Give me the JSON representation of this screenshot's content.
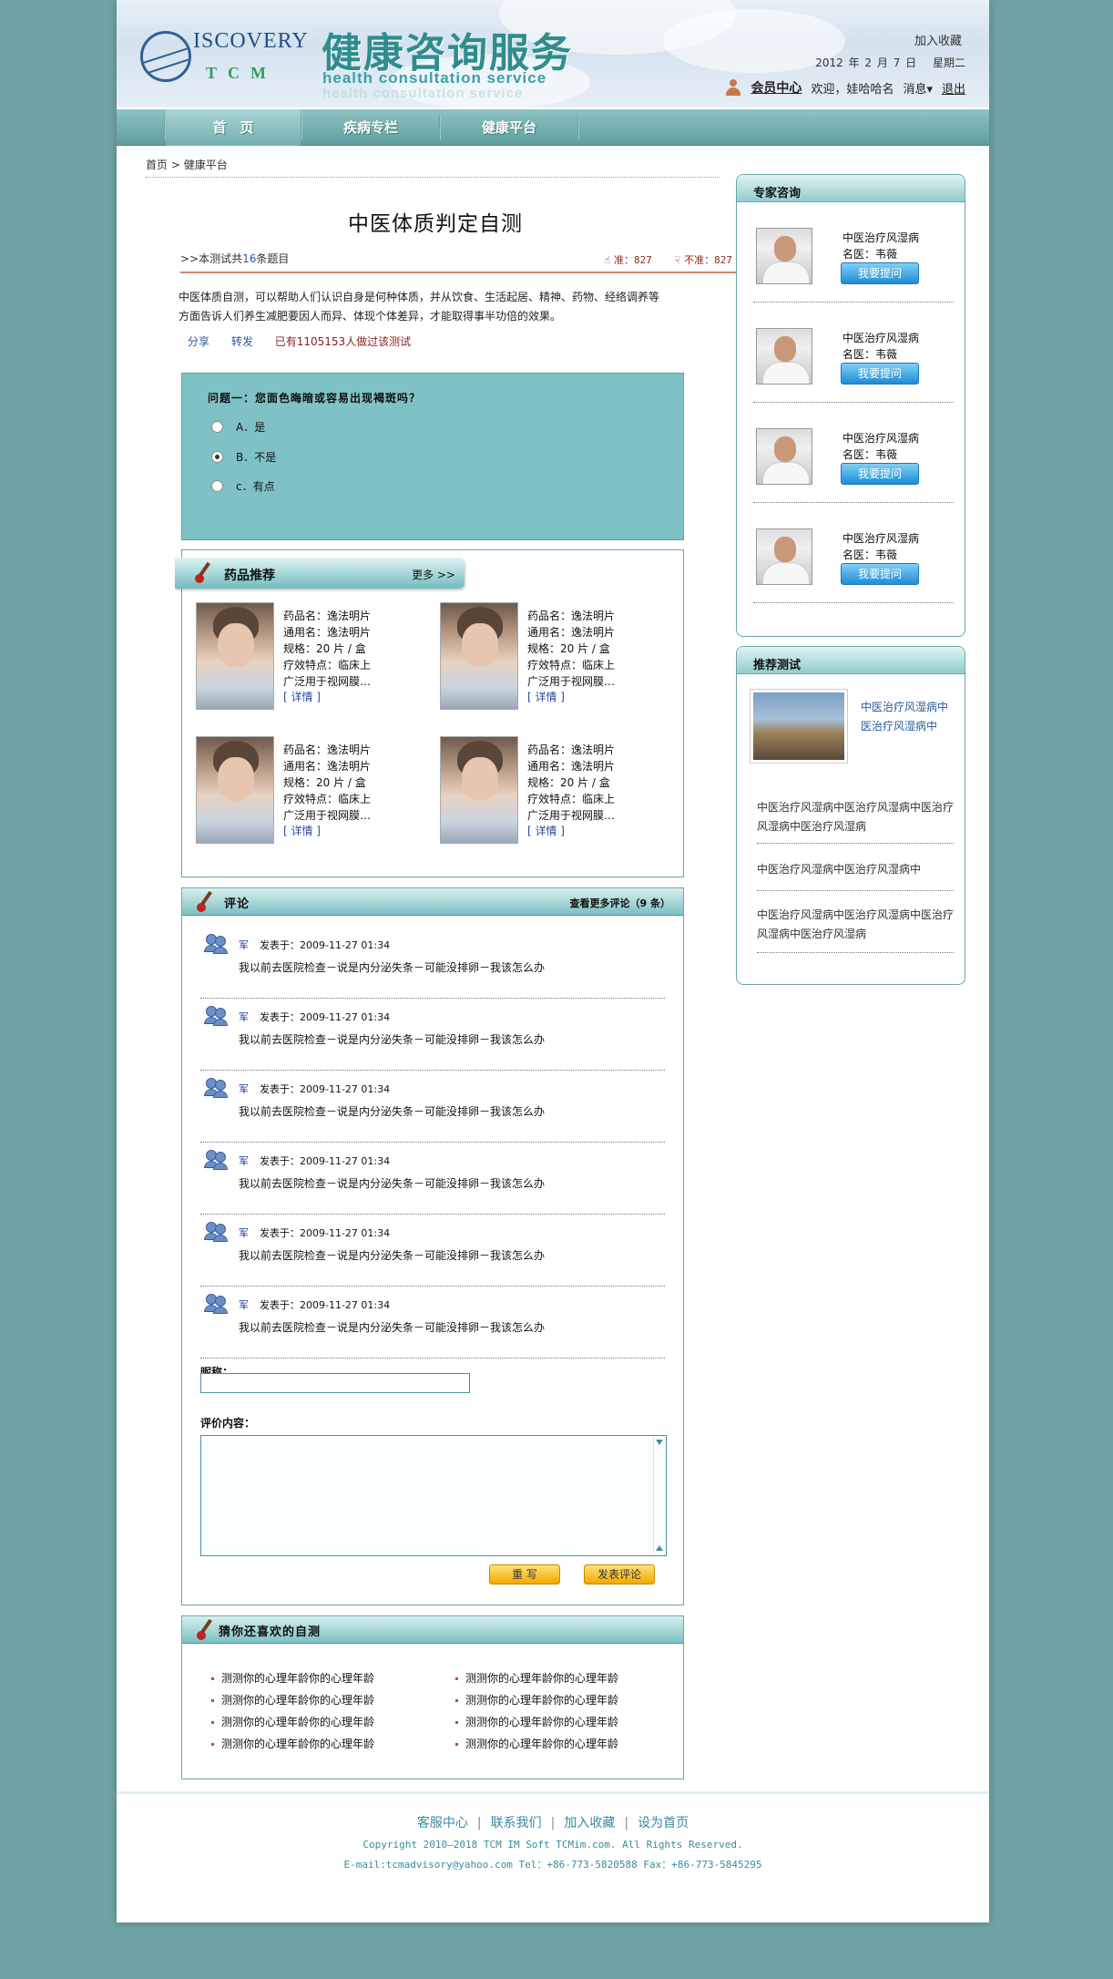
{
  "header": {
    "logo_brand": "ISCOVERY",
    "logo_sub": "TCM",
    "title": "健康咨询服务",
    "subtitle": "health consultation service",
    "add_favorite": "加入收藏",
    "date": "2012 年 2 月 7 日",
    "weekday": "星期二",
    "member_center": "会员中心",
    "welcome": "欢迎，娃哈哈名",
    "messages": "消息▾",
    "logout": "退出"
  },
  "nav": [
    {
      "label": "首　页",
      "active": true
    },
    {
      "label": "疾病专栏",
      "active": false
    },
    {
      "label": "健康平台",
      "active": false
    }
  ],
  "breadcrumb": {
    "home": "首页",
    "sep": ">",
    "current": "健康平台"
  },
  "test": {
    "title": "中医体质判定自测",
    "count_prefix": ">>本测试共",
    "count": "16",
    "count_suffix": "条题目",
    "accurate": "准：827",
    "inaccurate": "不准：827",
    "description": "中医体质自测，可以帮助人们认识自身是何种体质，并从饮食、生活起居、精神、药物、经络调养等方面告诉人们养生减肥要因人而异、体现个体差异，才能取得事半功倍的效果。",
    "share": "分享",
    "forward": "转发",
    "taken": "已有1105153人做过该测试"
  },
  "question": {
    "text": "问题一：您面色晦暗或容易出现褐斑吗？",
    "options": [
      {
        "label": "A．是",
        "selected": false
      },
      {
        "label": "B．不是",
        "selected": true
      },
      {
        "label": "c．有点",
        "selected": false
      }
    ]
  },
  "drugs": {
    "title": "药品推荐",
    "more": "更多 >>",
    "items": [
      {
        "name": "药品名：逸法明片",
        "generic": "通用名：逸法明片",
        "spec": "规格：20 片 / 盒",
        "feat": "疗效特点：临床上",
        "feat2": "广泛用于视网膜…",
        "detail": "[ 详情 ]"
      },
      {
        "name": "药品名：逸法明片",
        "generic": "通用名：逸法明片",
        "spec": "规格：20 片 / 盒",
        "feat": "疗效特点：临床上",
        "feat2": "广泛用于视网膜…",
        "detail": "[ 详情 ]"
      },
      {
        "name": "药品名：逸法明片",
        "generic": "通用名：逸法明片",
        "spec": "规格：20 片 / 盒",
        "feat": "疗效特点：临床上",
        "feat2": "广泛用于视网膜…",
        "detail": "[ 详情 ]"
      },
      {
        "name": "药品名：逸法明片",
        "generic": "通用名：逸法明片",
        "spec": "规格：20 片 / 盒",
        "feat": "疗效特点：临床上",
        "feat2": "广泛用于视网膜…",
        "detail": "[ 详情 ]"
      }
    ]
  },
  "comments": {
    "title": "评论",
    "more": "查看更多评论（9 条）",
    "items": [
      {
        "user": "军",
        "time": "发表于：2009-11-27 01:34",
        "text": "我以前去医院检查－说是内分泌失条－可能没排卵－我该怎么办"
      },
      {
        "user": "军",
        "time": "发表于：2009-11-27 01:34",
        "text": "我以前去医院检查－说是内分泌失条－可能没排卵－我该怎么办"
      },
      {
        "user": "军",
        "time": "发表于：2009-11-27 01:34",
        "text": "我以前去医院检查－说是内分泌失条－可能没排卵－我该怎么办"
      },
      {
        "user": "军",
        "time": "发表于：2009-11-27 01:34",
        "text": "我以前去医院检查－说是内分泌失条－可能没排卵－我该怎么办"
      },
      {
        "user": "军",
        "time": "发表于：2009-11-27 01:34",
        "text": "我以前去医院检查－说是内分泌失条－可能没排卵－我该怎么办"
      },
      {
        "user": "军",
        "time": "发表于：2009-11-27 01:34",
        "text": "我以前去医院检查－说是内分泌失条－可能没排卵－我该怎么办"
      }
    ],
    "nick_label": "昵称：",
    "content_label": "评价内容：",
    "reset": "重 写",
    "submit": "发表评论"
  },
  "guess": {
    "title": "猜你还喜欢的自测",
    "items": [
      "测测你的心理年龄你的心理年龄",
      "测测你的心理年龄你的心理年龄",
      "测测你的心理年龄你的心理年龄",
      "测测你的心理年龄你的心理年龄",
      "测测你的心理年龄你的心理年龄",
      "测测你的心理年龄你的心理年龄",
      "测测你的心理年龄你的心理年龄",
      "测测你的心理年龄你的心理年龄"
    ]
  },
  "experts": {
    "title": "专家咨询",
    "items": [
      {
        "topic": "中医治疗风湿病",
        "name": "名医：韦薇",
        "ask": "我要提问"
      },
      {
        "topic": "中医治疗风湿病",
        "name": "名医：韦薇",
        "ask": "我要提问"
      },
      {
        "topic": "中医治疗风湿病",
        "name": "名医：韦薇",
        "ask": "我要提问"
      },
      {
        "topic": "中医治疗风湿病",
        "name": "名医：韦薇",
        "ask": "我要提问"
      }
    ]
  },
  "recommend": {
    "title": "推荐测试",
    "featured": "中医治疗风湿病中医治疗风湿病中",
    "links": [
      "中医治疗风湿病中医治疗风湿病中医治疗风湿病中医治疗风湿病",
      "中医治疗风湿病中医治疗风湿病中",
      "中医治疗风湿病中医治疗风湿病中医治疗风湿病中医治疗风湿病"
    ]
  },
  "footer": {
    "links": [
      "客服中心",
      "联系我们",
      "加入收藏",
      "设为首页"
    ],
    "copyright": "Copyright 2010—2018 TCM IM Soft TCMim.com. All Rights Reserved.",
    "contact": "E-mail:tcmadvisory@yahoo.com Tel：+86-773-5820588 Fax：+86-773-5845295"
  },
  "colors": {
    "background": "#6fa3a3",
    "teal": "#7fc2c6",
    "accent_link": "#2c5aa0"
  }
}
